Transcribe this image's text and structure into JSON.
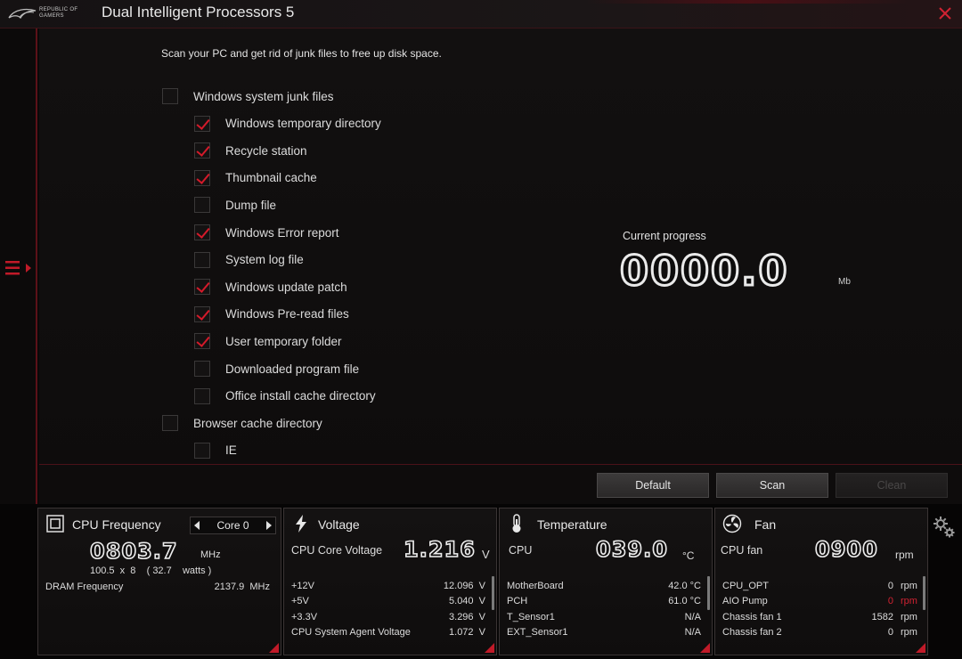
{
  "titlebar": {
    "logo_line1": "REPUBLIC OF",
    "logo_line2": "GAMERS",
    "title": "Dual Intelligent Processors 5",
    "close_icon": "close-icon"
  },
  "main": {
    "intro": "Scan your PC and get rid of junk files to free up disk space.",
    "items": [
      {
        "label": "Windows system junk files",
        "checked": false,
        "level": 0
      },
      {
        "label": "Windows temporary directory",
        "checked": true,
        "level": 1
      },
      {
        "label": "Recycle station",
        "checked": true,
        "level": 1
      },
      {
        "label": "Thumbnail cache",
        "checked": true,
        "level": 1
      },
      {
        "label": "Dump file",
        "checked": false,
        "level": 1
      },
      {
        "label": "Windows Error report",
        "checked": true,
        "level": 1
      },
      {
        "label": "System log file",
        "checked": false,
        "level": 1
      },
      {
        "label": "Windows update patch",
        "checked": true,
        "level": 1
      },
      {
        "label": "Windows Pre-read files",
        "checked": true,
        "level": 1
      },
      {
        "label": "User temporary folder",
        "checked": true,
        "level": 1
      },
      {
        "label": "Downloaded program file",
        "checked": false,
        "level": 1
      },
      {
        "label": "Office install cache directory",
        "checked": false,
        "level": 1
      },
      {
        "label": "Browser cache directory",
        "checked": false,
        "level": 0
      },
      {
        "label": "IE",
        "checked": false,
        "level": 1
      }
    ],
    "progress_label": "Current progress",
    "progress_value": "0000.0",
    "progress_unit": "Mb",
    "buttons": {
      "default": "Default",
      "scan": "Scan",
      "clean": "Clean"
    }
  },
  "cpu_freq": {
    "title": "CPU Frequency",
    "core_select": "Core 0",
    "value": "0803.7",
    "unit": "MHz",
    "multiplier_line": "100.5  x  8    ( 32.7    watts )",
    "dram_label": "DRAM Frequency",
    "dram_value": "2137.9  MHz"
  },
  "voltage": {
    "title": "Voltage",
    "core_label": "CPU Core Voltage",
    "core_value": "1.216",
    "core_unit": "V",
    "rows": [
      {
        "label": "+12V",
        "value": "12.096  V"
      },
      {
        "label": "+5V",
        "value": "5.040  V"
      },
      {
        "label": "+3.3V",
        "value": "3.296  V"
      },
      {
        "label": "CPU System Agent Voltage",
        "value": "1.072  V"
      }
    ]
  },
  "temperature": {
    "title": "Temperature",
    "cpu_label": "CPU",
    "cpu_value": "039.0",
    "cpu_unit": "°C",
    "rows": [
      {
        "label": "MotherBoard",
        "value": "42.0 °C"
      },
      {
        "label": "PCH",
        "value": "61.0 °C"
      },
      {
        "label": "T_Sensor1",
        "value": "N/A"
      },
      {
        "label": "EXT_Sensor1",
        "value": "N/A"
      }
    ]
  },
  "fan": {
    "title": "Fan",
    "cpu_label": "CPU fan",
    "cpu_value": "0900",
    "cpu_unit": "rpm",
    "rows": [
      {
        "label": "CPU_OPT",
        "value": "0",
        "unit": "rpm",
        "alert": false
      },
      {
        "label": "AIO Pump",
        "value": "0",
        "unit": "rpm",
        "alert": true
      },
      {
        "label": "Chassis fan 1",
        "value": "1582",
        "unit": "rpm",
        "alert": false
      },
      {
        "label": "Chassis fan 2",
        "value": "0",
        "unit": "rpm",
        "alert": false
      }
    ]
  },
  "colors": {
    "accent": "#c01a28",
    "check": "#d41a2a",
    "background": "#0e0c0c"
  }
}
